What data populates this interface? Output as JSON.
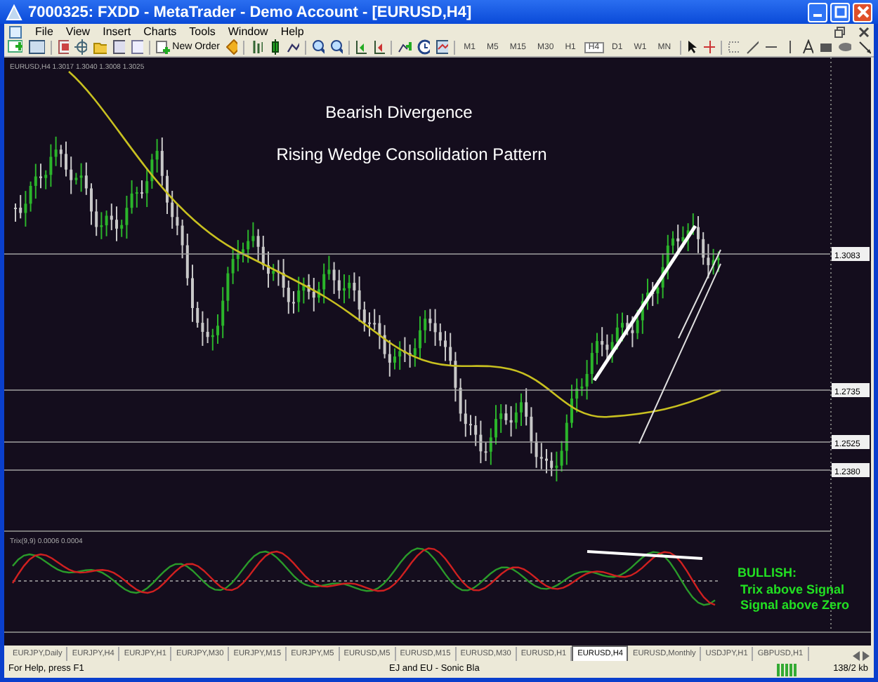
{
  "window": {
    "title": "7000325: FXDD - MetaTrader - Demo Account - [EURUSD,H4]"
  },
  "menu": [
    "File",
    "View",
    "Insert",
    "Charts",
    "Tools",
    "Window",
    "Help"
  ],
  "toolbar": {
    "new_order": "New Order",
    "timeframes": [
      {
        "label": "M1",
        "selected": false
      },
      {
        "label": "M5",
        "selected": false
      },
      {
        "label": "M15",
        "selected": false
      },
      {
        "label": "M30",
        "selected": false
      },
      {
        "label": "H1",
        "selected": false
      },
      {
        "label": "H4",
        "selected": true
      },
      {
        "label": "D1",
        "selected": false
      },
      {
        "label": "W1",
        "selected": false
      },
      {
        "label": "MN",
        "selected": false
      }
    ]
  },
  "chart": {
    "legend": "EURUSD,H4  1.3017 1.3040 1.3008 1.3025",
    "annotations": [
      "Bearish Divergence",
      "Rising Wedge Consolidation Pattern"
    ],
    "price_lines": [
      {
        "label": "1.3083"
      },
      {
        "label": "1.2735"
      },
      {
        "label": "1.2525"
      },
      {
        "label": "1.2380"
      }
    ],
    "indicator": {
      "legend": "Trix(9,9)  0.0006 0.0004",
      "signal_title": "BULLISH:",
      "signal_lines": [
        "Trix above Signal",
        "Signal above Zero"
      ]
    }
  },
  "tabs": [
    {
      "label": "EURJPY,Daily",
      "selected": false
    },
    {
      "label": "EURJPY,H4",
      "selected": false
    },
    {
      "label": "EURJPY,H1",
      "selected": false
    },
    {
      "label": "EURJPY,M30",
      "selected": false
    },
    {
      "label": "EURJPY,M15",
      "selected": false
    },
    {
      "label": "EURJPY,M5",
      "selected": false
    },
    {
      "label": "EURUSD,M5",
      "selected": false
    },
    {
      "label": "EURUSD,M15",
      "selected": false
    },
    {
      "label": "EURUSD,M30",
      "selected": false
    },
    {
      "label": "EURUSD,H1",
      "selected": false
    },
    {
      "label": "EURUSD,H4",
      "selected": true
    },
    {
      "label": "EURUSD,Monthly",
      "selected": false
    },
    {
      "label": "USDJPY,H1",
      "selected": false
    },
    {
      "label": "GBPUSD,H1",
      "selected": false
    }
  ],
  "status_bar": {
    "help": "For Help, press F1",
    "profile": "EJ and EU - Sonic Bla",
    "traffic": "138/2 kb"
  }
}
